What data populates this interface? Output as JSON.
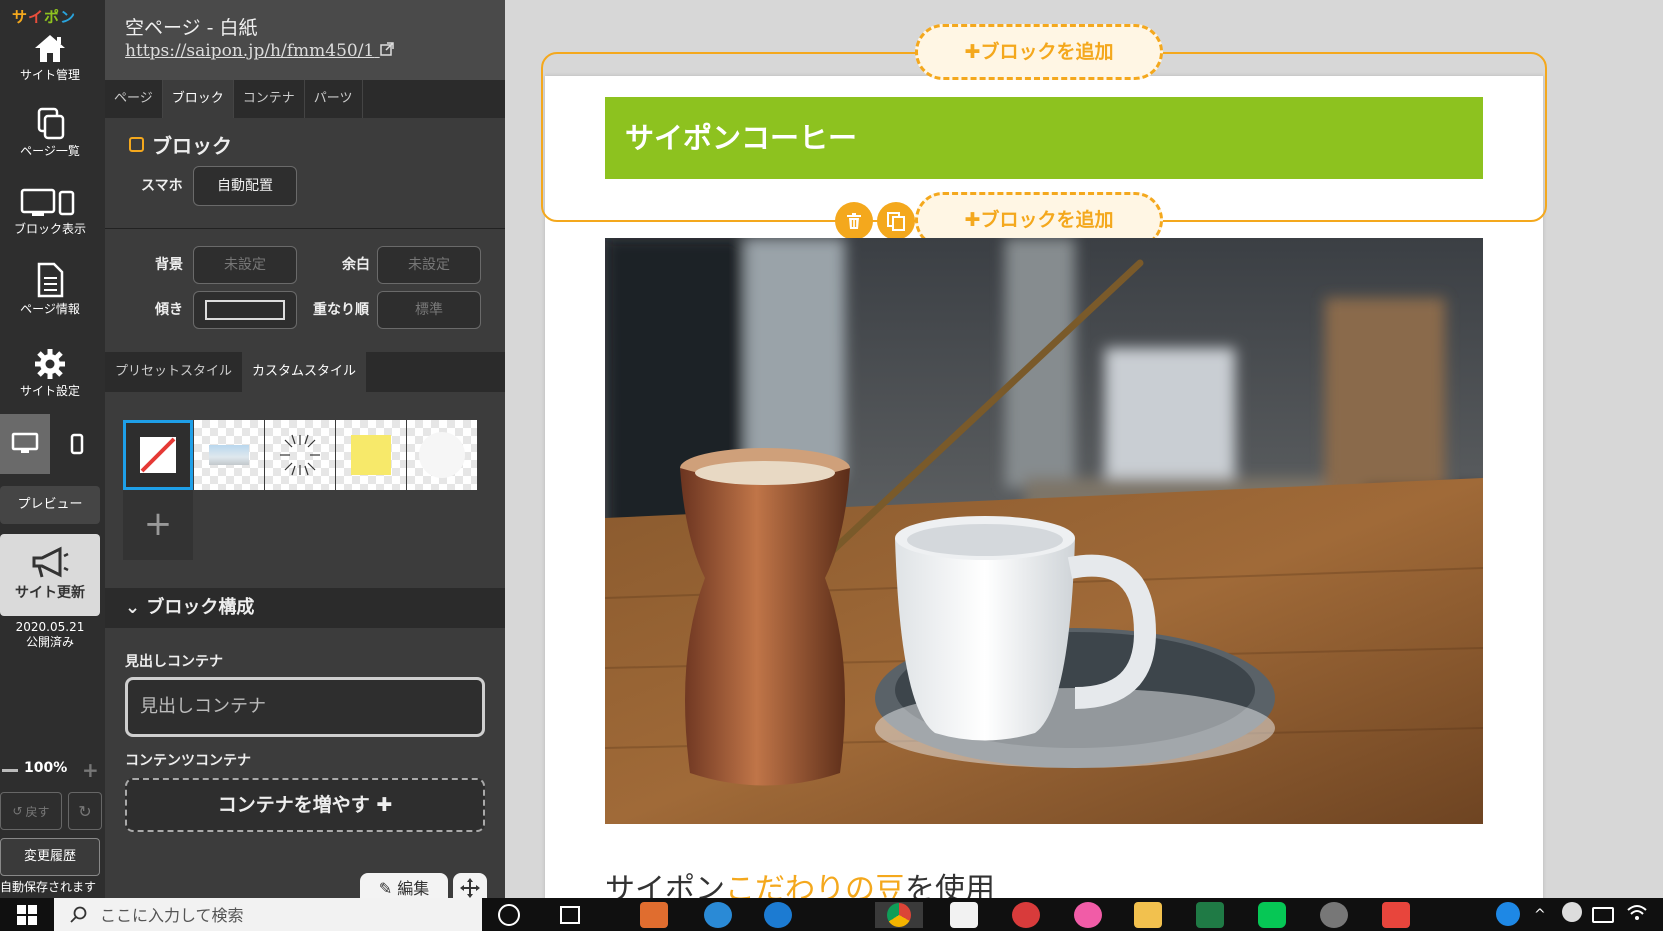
{
  "app": {
    "logo": [
      "サ",
      "イ",
      "ポ",
      "ン"
    ]
  },
  "rail": {
    "items": [
      {
        "label": "サイト管理"
      },
      {
        "label": "ページ一覧"
      },
      {
        "label": "ブロック表示"
      },
      {
        "label": "ページ情報"
      },
      {
        "label": "サイト設定"
      }
    ],
    "preview": "プレビュー",
    "publish": "サイト更新",
    "publish_date": "2020.05.21",
    "publish_status": "公開済み",
    "zoom": "100%",
    "undo": "戻す",
    "history": "変更履歴",
    "autosave": "自動保存されます"
  },
  "panel": {
    "page_title": "空ページ - 白紙",
    "page_url": "https://saipon.jp/h/fmm450/1",
    "tabs": [
      "ページ",
      "ブロック",
      "コンテナ",
      "パーツ"
    ],
    "active_tab": 1,
    "block_heading": "ブロック",
    "smartphone_label": "スマホ",
    "smartphone_value": "自動配置",
    "bg_label": "背景",
    "bg_value": "未設定",
    "margin_label": "余白",
    "margin_value": "未設定",
    "tilt_label": "傾き",
    "order_label": "重なり順",
    "order_value": "標準",
    "style_tabs": [
      "プリセットスタイル",
      "カスタムスタイル"
    ],
    "active_style_tab": 1,
    "compose_heading": "ブロック構成",
    "heading_container_label": "見出しコンテナ",
    "heading_container_value": "見出しコンテナ",
    "content_container_label": "コンテンツコンテナ",
    "add_container": "コンテナを増やす",
    "edit_tab": "編集"
  },
  "canvas": {
    "add_block": "ブロックを追加",
    "heading": "サイポンコーヒー",
    "caption_prefix": "サイポン",
    "caption_highlight": "こだわりの豆",
    "caption_suffix": "を使用",
    "colors": {
      "accent": "#f4a81d",
      "heading_bg": "#8dc21f"
    }
  },
  "taskbar": {
    "search_placeholder": "ここに入力して検索",
    "apps": [
      "cortana-icon",
      "task-view-icon",
      "media-player-icon",
      "internet-explorer-icon",
      "edge-icon",
      "chrome-icon",
      "store-icon",
      "photos-icon",
      "itunes-icon",
      "file-explorer-icon",
      "excel-icon",
      "line-icon",
      "media-icon",
      "screenshot-icon"
    ]
  }
}
